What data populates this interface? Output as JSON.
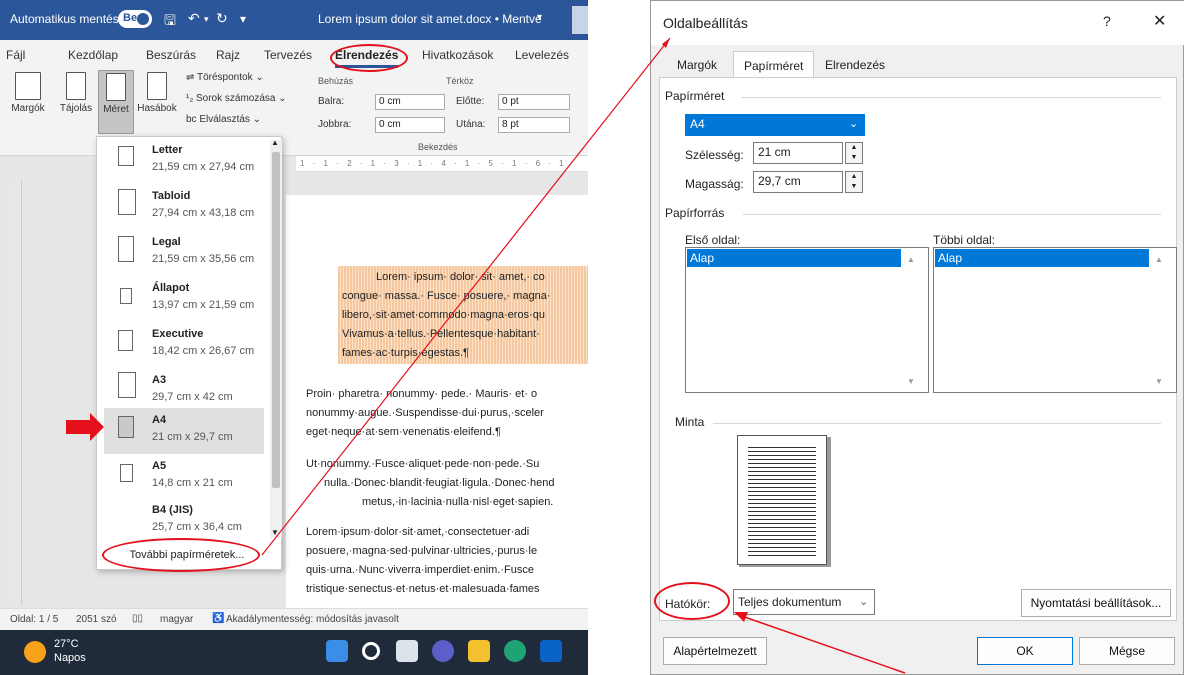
{
  "word": {
    "autosave_label": "Automatikus mentés",
    "autosave_state": "Be",
    "document_title": "Lorem ipsum dolor sit amet.docx • Mentve",
    "tabs": [
      "Fájl",
      "Kezdőlap",
      "Beszúrás",
      "Rajz",
      "Tervezés",
      "Elrendezés",
      "Hivatkozások",
      "Levelezés"
    ],
    "active_tab": "Elrendezés",
    "ribbon": {
      "margins": "Margók",
      "orientation": "Tájolás",
      "size": "Méret",
      "columns": "Hasábok",
      "breaks": "Töréspontok",
      "line_numbers": "Sorok számozása",
      "hyphenation": "Elválasztás",
      "indent_group": "Behúzás",
      "spacing_group": "Térköz",
      "left_label": "Balra:",
      "left_value": "0 cm",
      "right_label": "Jobbra:",
      "right_value": "0 cm",
      "before_label": "Előtte:",
      "before_value": "0 pt",
      "after_label": "Utána:",
      "after_value": "8 pt",
      "paragraph_group": "Bekezdés"
    },
    "ruler_top": "1 · 1 · 2 · 1 · 3 · 1 · 4 · 1 · 5 · 1 · 6 · 1",
    "size_menu": {
      "items": [
        {
          "name": "Letter",
          "dims": "21,59 cm x 27,94 cm"
        },
        {
          "name": "Tabloid",
          "dims": "27,94 cm x 43,18 cm"
        },
        {
          "name": "Legal",
          "dims": "21,59 cm x 35,56 cm"
        },
        {
          "name": "Állapot",
          "dims": "13,97 cm x 21,59 cm"
        },
        {
          "name": "Executive",
          "dims": "18,42 cm x 26,67 cm"
        },
        {
          "name": "A3",
          "dims": "29,7 cm x 42 cm"
        },
        {
          "name": "A4",
          "dims": "21 cm x 29,7 cm"
        },
        {
          "name": "A5",
          "dims": "14,8 cm x 21 cm"
        },
        {
          "name": "B4 (JIS)",
          "dims": "25,7 cm x 36,4 cm"
        }
      ],
      "selected": "A4",
      "more_label": "További papírméretek..."
    },
    "document": {
      "highlight_lines": [
        "Lorem· ipsum· dolor· sit· amet,· co",
        "congue· massa.· Fusce· posuere,· magna·",
        "libero,·sit·amet·commodo·magna·eros·qu",
        "Vivamus·a·tellus.·Pellentesque·habitant·",
        "fames·ac·turpis·egestas.¶"
      ],
      "para2": [
        "Proin· pharetra· nonummy· pede.· Mauris· et· o",
        "nonummy·augue.·Suspendisse·dui·purus,·sceler",
        "eget·neque·at·sem·venenatis·eleifend.¶"
      ],
      "para3": [
        "Ut·nonummy.·Fusce·aliquet·pede·non·pede.·Su",
        "nulla.·Donec·blandit·feugiat·ligula.·Donec·hend",
        "metus,·in·lacinia·nulla·nisl·eget·sapien."
      ],
      "para4": [
        "Lorem·ipsum·dolor·sit·amet,·consectetuer·adi",
        "posuere,·magna·sed·pulvinar·ultricies,·purus·le",
        "quis·urna.·Nunc·viverra·imperdiet·enim.·Fusce",
        "tristique·senectus·et·netus·et·malesuada·fames"
      ]
    },
    "status": {
      "page": "Oldal: 1 / 5",
      "words": "2051 szó",
      "language": "magyar",
      "accessibility": "Akadálymentesség: módosítás javasolt"
    },
    "taskbar": {
      "temperature": "27°C",
      "weather": "Napos"
    }
  },
  "dialog": {
    "title": "Oldalbeállítás",
    "help": "?",
    "close": "✕",
    "tabs": [
      "Margók",
      "Papírméret",
      "Elrendezés"
    ],
    "active_tab": "Papírméret",
    "paper_size_section": "Papírméret",
    "paper_size_value": "A4",
    "width_label": "Szélesség:",
    "width_value": "21 cm",
    "height_label": "Magasság:",
    "height_value": "29,7 cm",
    "paper_source_section": "Papírforrás",
    "first_page_label": "Első oldal:",
    "first_page_selected": "Alap",
    "other_pages_label": "Többi oldal:",
    "other_pages_selected": "Alap",
    "preview_section": "Minta",
    "apply_to_label": "Hatókör:",
    "apply_to_value": "Teljes dokumentum",
    "print_options": "Nyomtatási beállítások...",
    "set_default": "Alapértelmezett",
    "ok": "OK",
    "cancel": "Mégse"
  },
  "colors": {
    "word_blue": "#2b579a",
    "annotation_red": "#e4101b",
    "selection_blue": "#0078d7",
    "highlight_orange": "#f6c89f"
  }
}
